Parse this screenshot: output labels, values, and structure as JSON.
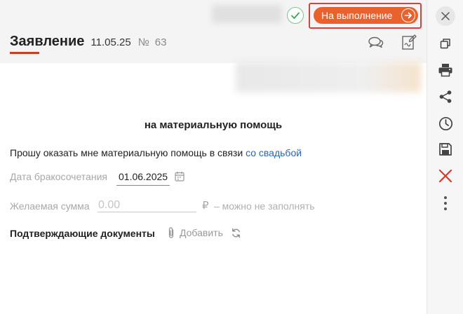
{
  "header": {
    "status_button_label": "На выполнение",
    "title": "Заявление",
    "date": "11.05.25",
    "number_symbol": "№",
    "number": "63",
    "accent_color": "#e9622d"
  },
  "document": {
    "heading": "на материальную помощь",
    "request_text": "Прошу оказать мне материальную помощь в связи ",
    "request_reason": "со свадьбой",
    "marriage_date_label": "Дата бракосочетания",
    "marriage_date_value": "01.06.2025",
    "amount_label": "Желаемая сумма",
    "amount_placeholder": "0.00",
    "currency_symbol": "₽",
    "amount_hint": "– можно не заполнять",
    "docs_label": "Подтверждающие документы",
    "add_label": "Добавить"
  },
  "rail": {
    "icons": [
      "close-icon",
      "copy-icon",
      "printer-icon",
      "share-icon",
      "history-icon",
      "save-icon",
      "delete-icon",
      "more-icon"
    ],
    "delete_color": "#d43a2f"
  }
}
